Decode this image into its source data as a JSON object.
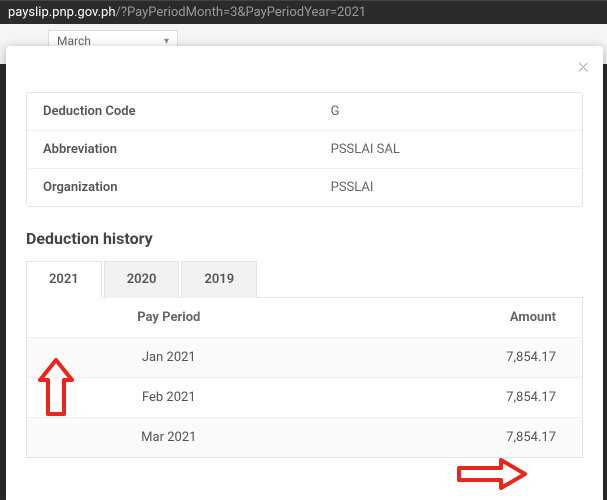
{
  "url": {
    "host": "payslip.pnp.gov.ph",
    "path": "/?PayPeriodMonth=3&PayPeriodYear=2021"
  },
  "bg_dropdown": "March",
  "info": {
    "rows": [
      {
        "label": "Deduction Code",
        "value": "G"
      },
      {
        "label": "Abbreviation",
        "value": "PSSLAI SAL"
      },
      {
        "label": "Organization",
        "value": "PSSLAI"
      }
    ]
  },
  "section_title": "Deduction history",
  "tabs": [
    "2021",
    "2020",
    "2019"
  ],
  "active_tab": "2021",
  "table": {
    "headers": {
      "period": "Pay Period",
      "amount": "Amount"
    },
    "rows": [
      {
        "period": "Jan 2021",
        "amount": "7,854.17"
      },
      {
        "period": "Feb 2021",
        "amount": "7,854.17"
      },
      {
        "period": "Mar 2021",
        "amount": "7,854.17"
      }
    ]
  },
  "annotations": {
    "arrow_up_target": "tab-2021",
    "arrow_right_target": "amount-mar-2021"
  }
}
